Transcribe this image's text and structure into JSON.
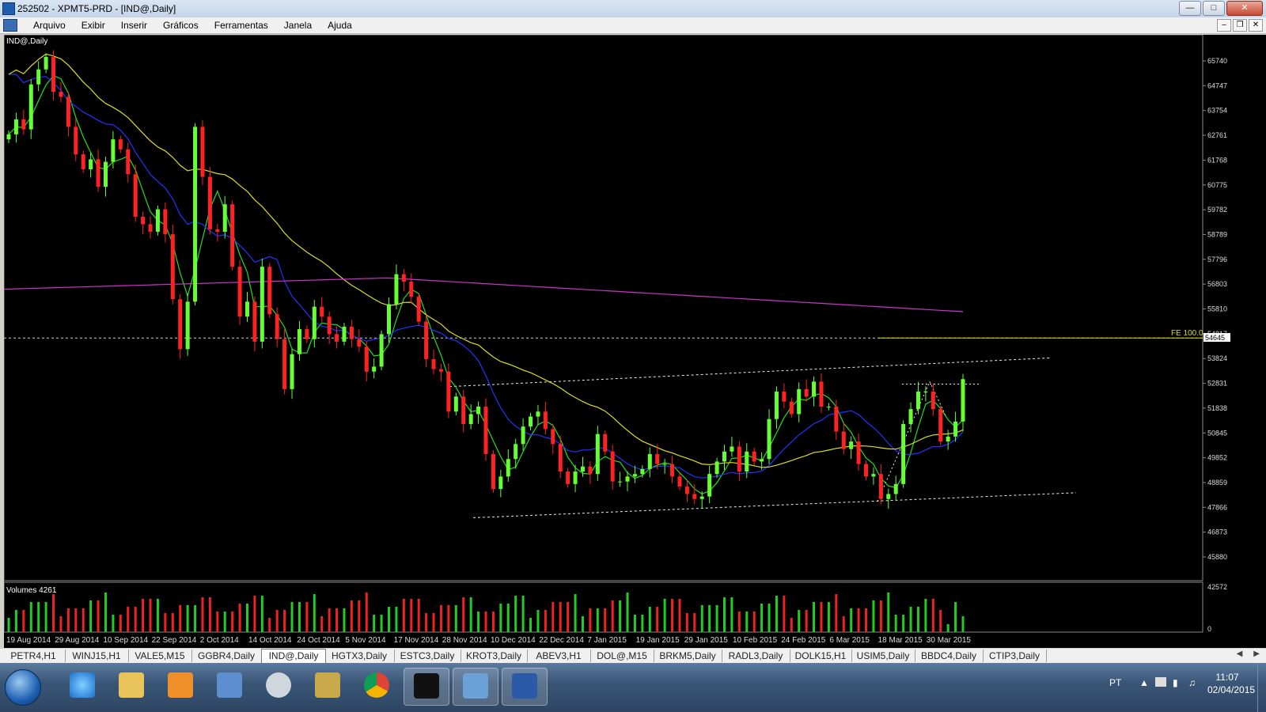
{
  "window": {
    "title": "252502 - XPMT5-PRD - [IND@,Daily]"
  },
  "menu": [
    "Arquivo",
    "Exibir",
    "Inserir",
    "Gráficos",
    "Ferramentas",
    "Janela",
    "Ajuda"
  ],
  "chart": {
    "symbol_label": "IND@,Daily",
    "price_ticks": [
      "65740",
      "64747",
      "63754",
      "62761",
      "61768",
      "60775",
      "59782",
      "58789",
      "57796",
      "56803",
      "55810",
      "54817",
      "53824",
      "52831",
      "51838",
      "50845",
      "49852",
      "48859",
      "47866",
      "46873",
      "45880"
    ],
    "current_price": "54645",
    "fe_label": "FE 100.0",
    "colors": {
      "background": "#000000",
      "bull": "#66ff33",
      "bear": "#ff2222",
      "ma_fast": "#22dd22",
      "ma_mid": "#2233ff",
      "ma_slow": "#dddd22",
      "ma_200": "#cc33cc",
      "fe_line": "#dddd00"
    },
    "volume_label": "Volumes 4261",
    "volume_ticks": [
      "42572",
      "0"
    ],
    "date_ticks": [
      "19 Aug 2014",
      "29 Aug 2014",
      "10 Sep 2014",
      "22 Sep 2014",
      "2 Oct 2014",
      "14 Oct 2014",
      "24 Oct 2014",
      "5 Nov 2014",
      "17 Nov 2014",
      "28 Nov 2014",
      "10 Dec 2014",
      "22 Dec 2014",
      "7 Jan 2015",
      "19 Jan 2015",
      "29 Jan 2015",
      "10 Feb 2015",
      "24 Feb 2015",
      "6 Mar 2015",
      "18 Mar 2015",
      "30 Mar 2015"
    ]
  },
  "chart_data": {
    "type": "candlestick",
    "close_series": [
      62800,
      63400,
      63000,
      64800,
      65400,
      65900,
      64500,
      64300,
      63100,
      62000,
      61400,
      61800,
      60700,
      61700,
      62600,
      62200,
      61200,
      59500,
      59200,
      58900,
      59800,
      58800,
      56200,
      54200,
      56100,
      63100,
      61100,
      59000,
      58900,
      60000,
      57500,
      55500,
      56100,
      54500,
      57500,
      55600,
      54600,
      52600,
      54000,
      55000,
      54600,
      55900,
      55500,
      54800,
      54500,
      55100,
      54600,
      54300,
      53300,
      53500,
      54800,
      56000,
      57200,
      56900,
      56300,
      55300,
      53800,
      53400,
      53300,
      51700,
      52300,
      51200,
      51600,
      51900,
      50000,
      48600,
      49100,
      49800,
      50400,
      51100,
      51500,
      51700,
      51000,
      50400,
      49300,
      48800,
      49300,
      49500,
      49200,
      50800,
      50100,
      48900,
      48900,
      49100,
      49200,
      49400,
      50000,
      49600,
      49600,
      49100,
      48700,
      48400,
      48200,
      48300,
      49200,
      49700,
      50100,
      50300,
      49300,
      50100,
      49700,
      49800,
      51400,
      52500,
      52100,
      51600,
      52600,
      52300,
      52900,
      51900,
      51900,
      50900,
      50200,
      50500,
      49600,
      49100,
      49200,
      48200,
      48400,
      48800,
      51200,
      51800,
      52500,
      52500,
      51800,
      50500,
      50700,
      51300,
      53000
    ],
    "ma_200_range": [
      56600,
      55700
    ],
    "fe_level": 54645,
    "volume_max": 42572
  },
  "tabs": [
    "PETR4,H1",
    "WINJ15,H1",
    "VALE5,M15",
    "GGBR4,Daily",
    "IND@,Daily",
    "HGTX3,Daily",
    "ESTC3,Daily",
    "KROT3,Daily",
    "ABEV3,H1",
    "DOL@,M15",
    "BRKM5,Daily",
    "RADL3,Daily",
    "DOLK15,H1",
    "USIM5,Daily",
    "BBDC4,Daily",
    "CTIP3,Daily"
  ],
  "tray": {
    "lang": "PT",
    "time": "11:07",
    "date": "02/04/2015"
  }
}
